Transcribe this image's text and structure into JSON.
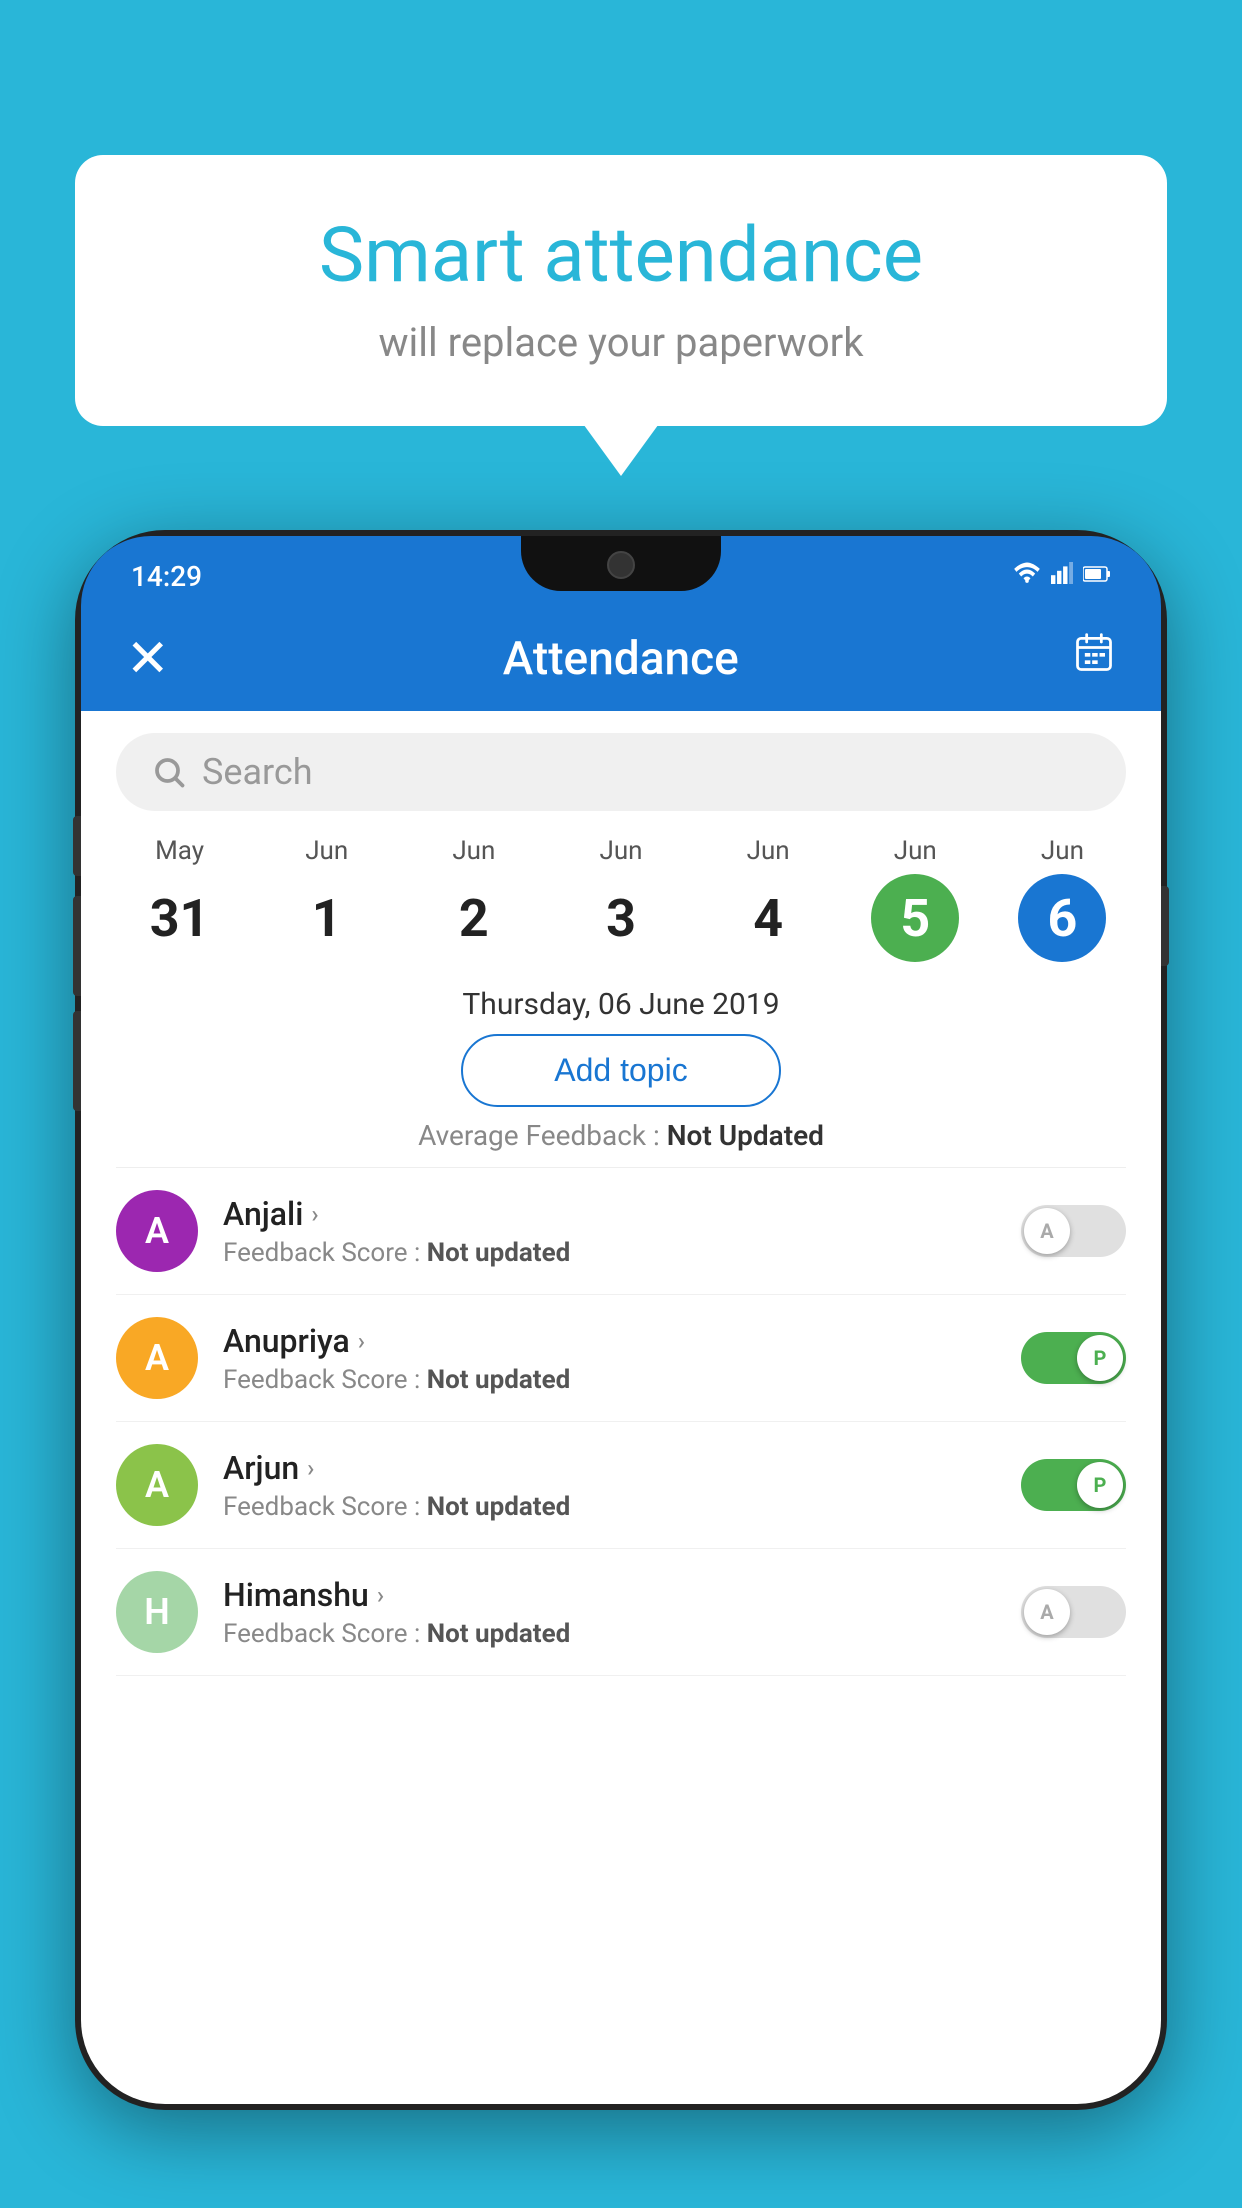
{
  "background_color": "#29B6D8",
  "bubble": {
    "title": "Smart attendance",
    "subtitle": "will replace your paperwork"
  },
  "status_bar": {
    "time": "14:29",
    "icons": [
      "wifi",
      "signal",
      "battery"
    ]
  },
  "app_bar": {
    "title": "Attendance",
    "close_label": "×",
    "calendar_label": "📅"
  },
  "search": {
    "placeholder": "Search"
  },
  "calendar": {
    "days": [
      {
        "month": "May",
        "date": "31",
        "state": "normal"
      },
      {
        "month": "Jun",
        "date": "1",
        "state": "normal"
      },
      {
        "month": "Jun",
        "date": "2",
        "state": "normal"
      },
      {
        "month": "Jun",
        "date": "3",
        "state": "normal"
      },
      {
        "month": "Jun",
        "date": "4",
        "state": "normal"
      },
      {
        "month": "Jun",
        "date": "5",
        "state": "today"
      },
      {
        "month": "Jun",
        "date": "6",
        "state": "selected"
      }
    ],
    "selected_date_display": "Thursday, 06 June 2019"
  },
  "add_topic_label": "Add topic",
  "avg_feedback_label": "Average Feedback :",
  "avg_feedback_value": "Not Updated",
  "students": [
    {
      "name": "Anjali",
      "avatar_letter": "A",
      "avatar_color": "#9C27B0",
      "feedback_label": "Feedback Score :",
      "feedback_value": "Not updated",
      "toggle": "off",
      "toggle_label": "A"
    },
    {
      "name": "Anupriya",
      "avatar_letter": "A",
      "avatar_color": "#F9A825",
      "feedback_label": "Feedback Score :",
      "feedback_value": "Not updated",
      "toggle": "on",
      "toggle_label": "P"
    },
    {
      "name": "Arjun",
      "avatar_letter": "A",
      "avatar_color": "#8BC34A",
      "feedback_label": "Feedback Score :",
      "feedback_value": "Not updated",
      "toggle": "on",
      "toggle_label": "P"
    },
    {
      "name": "Himanshu",
      "avatar_letter": "H",
      "avatar_color": "#A5D6A7",
      "feedback_label": "Feedback Score :",
      "feedback_value": "Not updated",
      "toggle": "off",
      "toggle_label": "A"
    }
  ]
}
